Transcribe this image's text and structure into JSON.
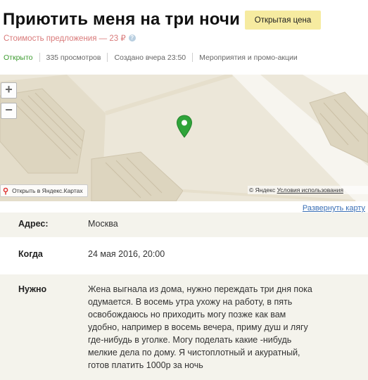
{
  "listing": {
    "title": "Приютить меня на три ночи",
    "badge": "Открытая цена",
    "cost": "Стоимость предложения — 23 ₽",
    "status": "Открыто",
    "views": "335 просмотров",
    "created": "Создано вчера 23:50",
    "category": "Мероприятия и промо-акции"
  },
  "map": {
    "open_yandex": "Открыть в Яндекс.Картах",
    "copyright_brand": "© Яндекс",
    "copyright_link": "Условия использования",
    "expand": "Развернуть карту",
    "pin_color": "#2fa43a"
  },
  "details": {
    "address_label": "Адрес:",
    "address_value": "Москва",
    "when_label": "Когда",
    "when_value": "24 мая 2016, 20:00",
    "needs_label": "Нужно",
    "needs_lines": [
      "Жена выгнала из дома, нужно переждать три дня пока",
      "одумается. В восемь утра ухожу на работу, в  пять",
      "освобождаюсь но приходить могу позже как вам",
      "удобно, например в восемь вечера, приму душ и лягу",
      "где-нибудь в уголке. Могу поделать какие -нибудь",
      "мелкие дела по дому. Я чистоплотный и акуратный,",
      "готов платить 1000р за ночь"
    ]
  },
  "icons": [
    "info-icon",
    "zoom-in-icon",
    "zoom-out-icon",
    "map-pin-icon",
    "location-pin-icon"
  ]
}
